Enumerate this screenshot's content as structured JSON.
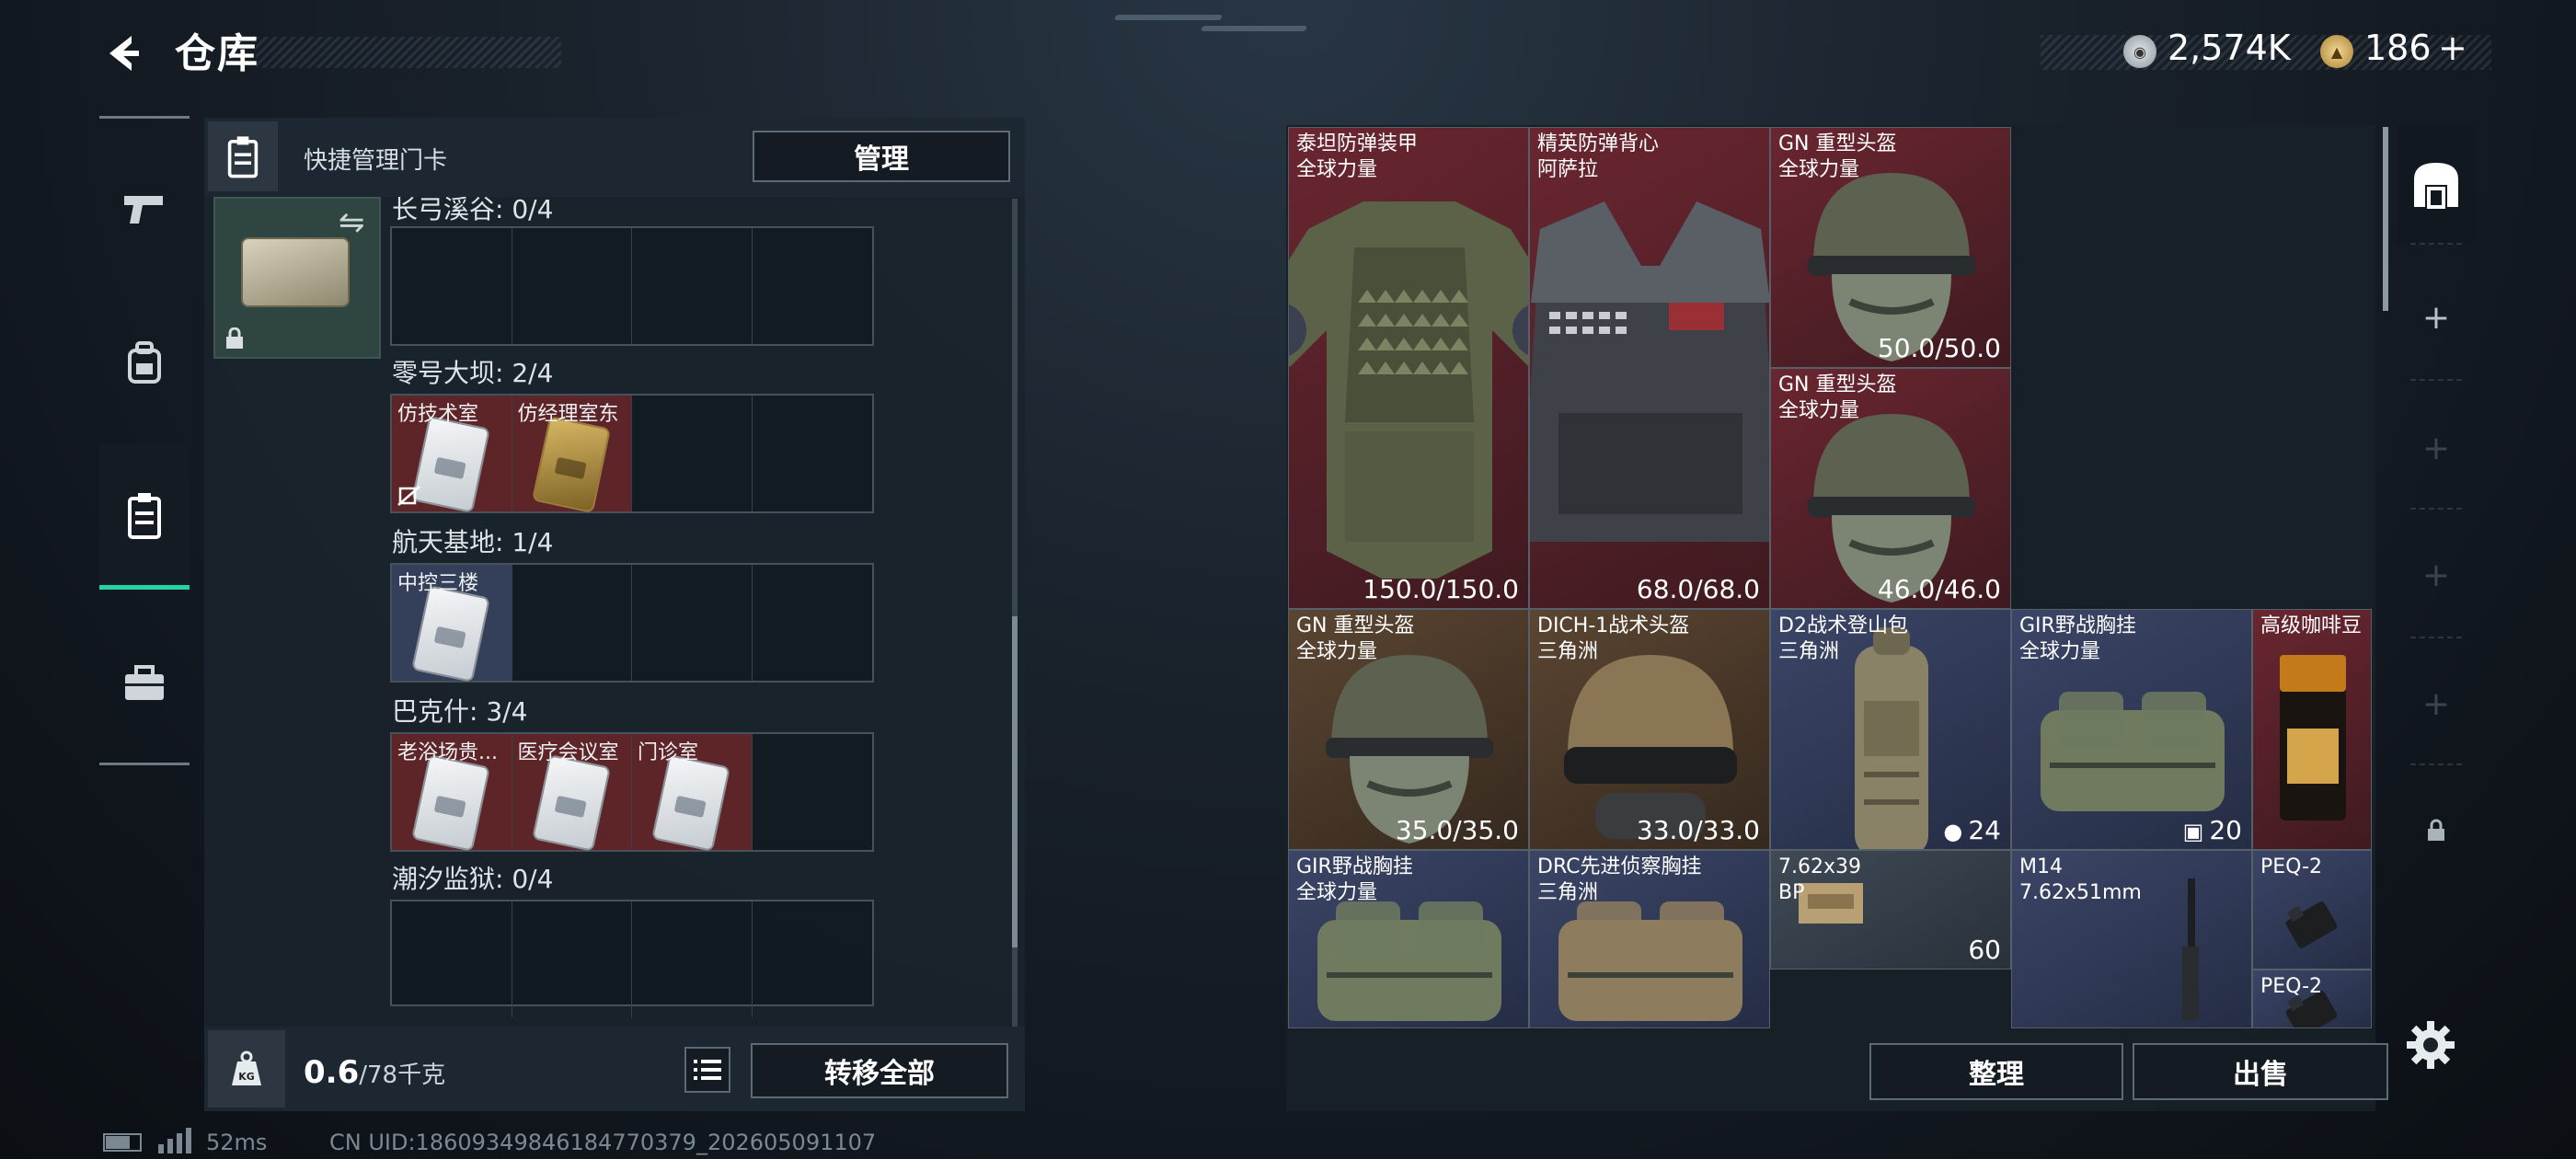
{
  "header": {
    "title": "仓库"
  },
  "currency": [
    {
      "icon": "silver-coin-icon",
      "value": "2,574K"
    },
    {
      "icon": "gold-coin-icon",
      "value": "186"
    }
  ],
  "currency_add": "+",
  "left_panel": {
    "title": "快捷管理门卡",
    "manage_label": "管理",
    "locations": [
      {
        "name": "长弓溪谷: 0/4",
        "slots": []
      },
      {
        "name": "零号大坝: 2/4",
        "slots": [
          {
            "label": "仿技术室",
            "rarity": "red",
            "card": "white"
          },
          {
            "label": "仿经理室东",
            "rarity": "red",
            "card": "gold"
          }
        ]
      },
      {
        "name": "航天基地: 1/4",
        "slots": [
          {
            "label": "中控三楼",
            "rarity": "blue",
            "card": "white"
          }
        ]
      },
      {
        "name": "巴克什: 3/4",
        "slots": [
          {
            "label": "老浴场贵...",
            "rarity": "red",
            "card": "white"
          },
          {
            "label": "医疗会议室",
            "rarity": "red",
            "card": "white"
          },
          {
            "label": "门诊室",
            "rarity": "red",
            "card": "white"
          }
        ]
      },
      {
        "name": "潮汐监狱: 0/4",
        "slots": []
      }
    ],
    "weight_value": "0.6",
    "weight_max": "/78千克",
    "transfer_all_label": "转移全部"
  },
  "status": {
    "ping": "52ms",
    "uid": "CN UID:18609349846184770379_202605091107"
  },
  "inventory": {
    "items": [
      {
        "name": "泰坦防弹装甲",
        "sub": "全球力量",
        "value": "150.0/150.0",
        "rarity": "red",
        "art": "armor"
      },
      {
        "name": "精英防弹背心",
        "sub": "阿萨拉",
        "value": "68.0/68.0",
        "rarity": "red",
        "art": "vest"
      },
      {
        "name": "GN 重型头盔",
        "sub": "全球力量",
        "value": "50.0/50.0",
        "rarity": "red",
        "art": "helmet"
      },
      {
        "name": "GN 重型头盔",
        "sub": "全球力量",
        "value": "46.0/46.0",
        "rarity": "red",
        "art": "helmet"
      },
      {
        "name": "GN 重型头盔",
        "sub": "全球力量",
        "value": "35.0/35.0",
        "rarity": "brown",
        "art": "helmet"
      },
      {
        "name": "DICH-1战术头盔",
        "sub": "三角洲",
        "value": "33.0/33.0",
        "rarity": "brown",
        "art": "tanhelmet"
      },
      {
        "name": "D2战术登山包",
        "sub": "三角洲",
        "value": "24",
        "rarity": "blue",
        "art": "backpack"
      },
      {
        "name": "GIR野战胸挂",
        "sub": "全球力量",
        "value": "20",
        "rarity": "blue",
        "art": "rig"
      },
      {
        "name": "高级咖啡豆",
        "sub": "",
        "value": "",
        "rarity": "red",
        "art": "coffee"
      },
      {
        "name": "GIR野战胸挂",
        "sub": "全球力量",
        "value": "",
        "rarity": "blue",
        "art": "rig"
      },
      {
        "name": "DRC先进侦察胸挂",
        "sub": "三角洲",
        "value": "",
        "rarity": "blue",
        "art": "tanrig"
      },
      {
        "name": "7.62x39",
        "sub": "BP",
        "value": "60",
        "rarity": "gray",
        "art": "ammo"
      },
      {
        "name": "M14",
        "sub": "7.62x51mm",
        "value": "",
        "rarity": "blue",
        "art": "rifle"
      },
      {
        "name": "PEQ-2",
        "sub": "",
        "value": "",
        "rarity": "blue",
        "art": "peq"
      },
      {
        "name": "PEQ-2",
        "sub": "",
        "value": "",
        "rarity": "blue",
        "art": "peq"
      }
    ],
    "sort_label": "整理",
    "sell_label": "出售"
  },
  "right_nav": {
    "add_label": "+"
  },
  "colors": {
    "accent": "#24d3a4",
    "rarity_red": "#6a2630",
    "rarity_brown": "#5b4532",
    "rarity_blue": "#3b4566"
  }
}
